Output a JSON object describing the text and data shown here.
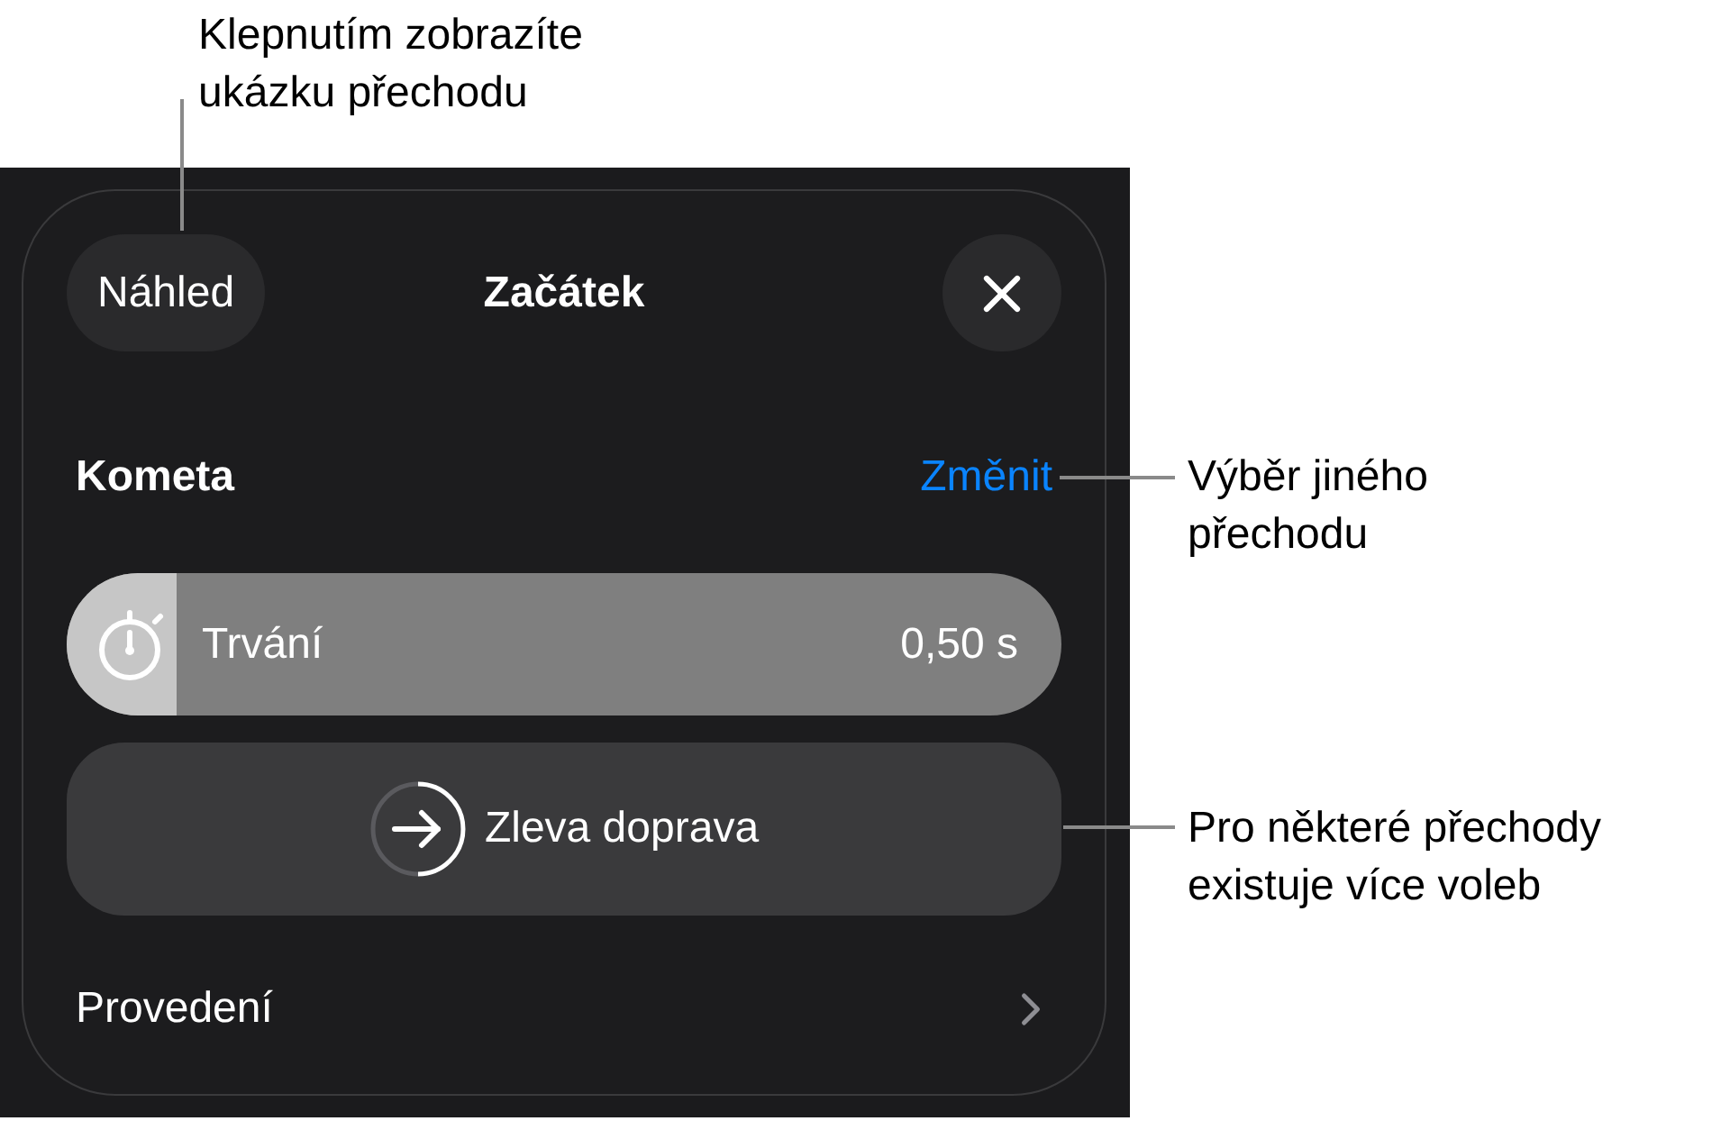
{
  "callouts": [
    {
      "text": "Klepnutím zobrazíte\nukázku přechodu"
    },
    {
      "text": "Výběr jiného\npřechodu"
    },
    {
      "text": "Pro některé přechody\nexistuje více voleb"
    }
  ],
  "sheet": {
    "preview_button": "Náhled",
    "title": "Začátek"
  },
  "transition": {
    "name": "Kometa",
    "change_link": "Změnit"
  },
  "duration": {
    "label": "Trvání",
    "value": "0,50 s",
    "level": 0.11
  },
  "direction_button": {
    "label": "Zleva doprava"
  },
  "rows": [
    {
      "label": "Provedení"
    }
  ]
}
